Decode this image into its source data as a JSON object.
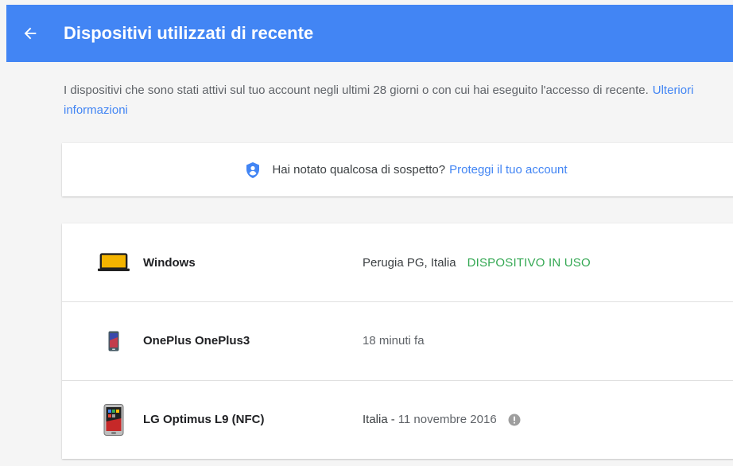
{
  "header": {
    "title": "Dispositivi utilizzati di recente",
    "background_color": "#4285f4"
  },
  "intro": {
    "text": "I dispositivi che sono stati attivi sul tuo account negli ultimi 28 giorni o con cui hai eseguito l'accesso di recente.",
    "link_label": "Ulteriori informazioni"
  },
  "alert": {
    "icon": "shield-icon",
    "text": "Hai notato qualcosa di sospetto?",
    "link_label": "Proteggi il tuo account"
  },
  "devices": [
    {
      "icon": "laptop-icon",
      "name": "Windows",
      "location": "Perugia PG, Italia",
      "status": "DISPOSITIVO IN USO"
    },
    {
      "icon": "phone-icon",
      "name": "OnePlus OnePlus3",
      "last_seen": "18 minuti fa"
    },
    {
      "icon": "phone-icon",
      "name": "LG Optimus L9 (NFC)",
      "location": "Italia",
      "separator": "-",
      "date": "11 novembre 2016"
    }
  ],
  "colors": {
    "accent": "#4285f4",
    "in_use": "#34a853",
    "laptop_screen": "#f4b400"
  }
}
